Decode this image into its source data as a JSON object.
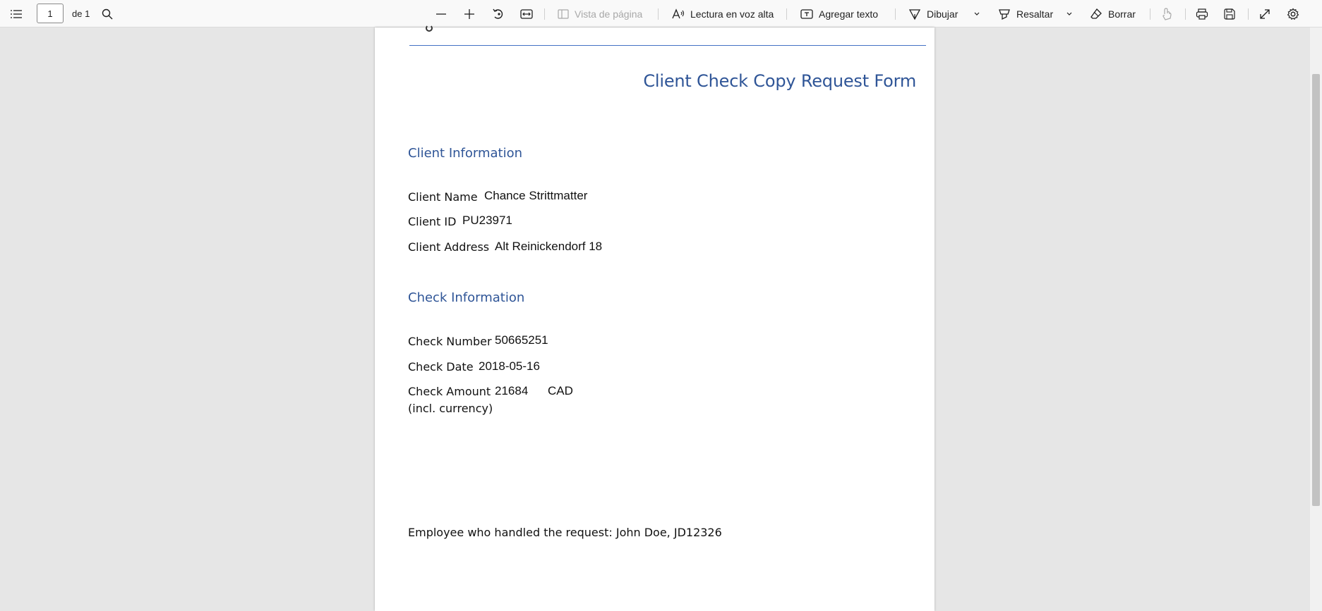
{
  "toolbar": {
    "page_number": "1",
    "page_count": "de 1",
    "page_view_label": "Vista de página",
    "read_aloud_label": "Lectura en voz alta",
    "add_text_label": "Agregar texto",
    "draw_label": "Dibujar",
    "highlight_label": "Resaltar",
    "erase_label": "Borrar"
  },
  "document": {
    "title": "Client Check Copy Request Form",
    "client_section": {
      "heading": "Client Information",
      "name_label": "Client Name",
      "name_value": "Chance Strittmatter",
      "id_label": "Client ID",
      "id_value": "PU23971",
      "address_label": "Client Address",
      "address_value": "Alt Reinickendorf 18"
    },
    "check_section": {
      "heading": "Check Information",
      "number_label": "Check Number",
      "number_value": "50665251",
      "date_label": "Check Date",
      "date_value": "2018-05-16",
      "amount_label": "Check Amount",
      "amount_label_2": "(incl. currency)",
      "amount_value": "21684",
      "currency_value": "CAD"
    },
    "footer": "Employee who handled the request: John Doe, JD12326"
  }
}
